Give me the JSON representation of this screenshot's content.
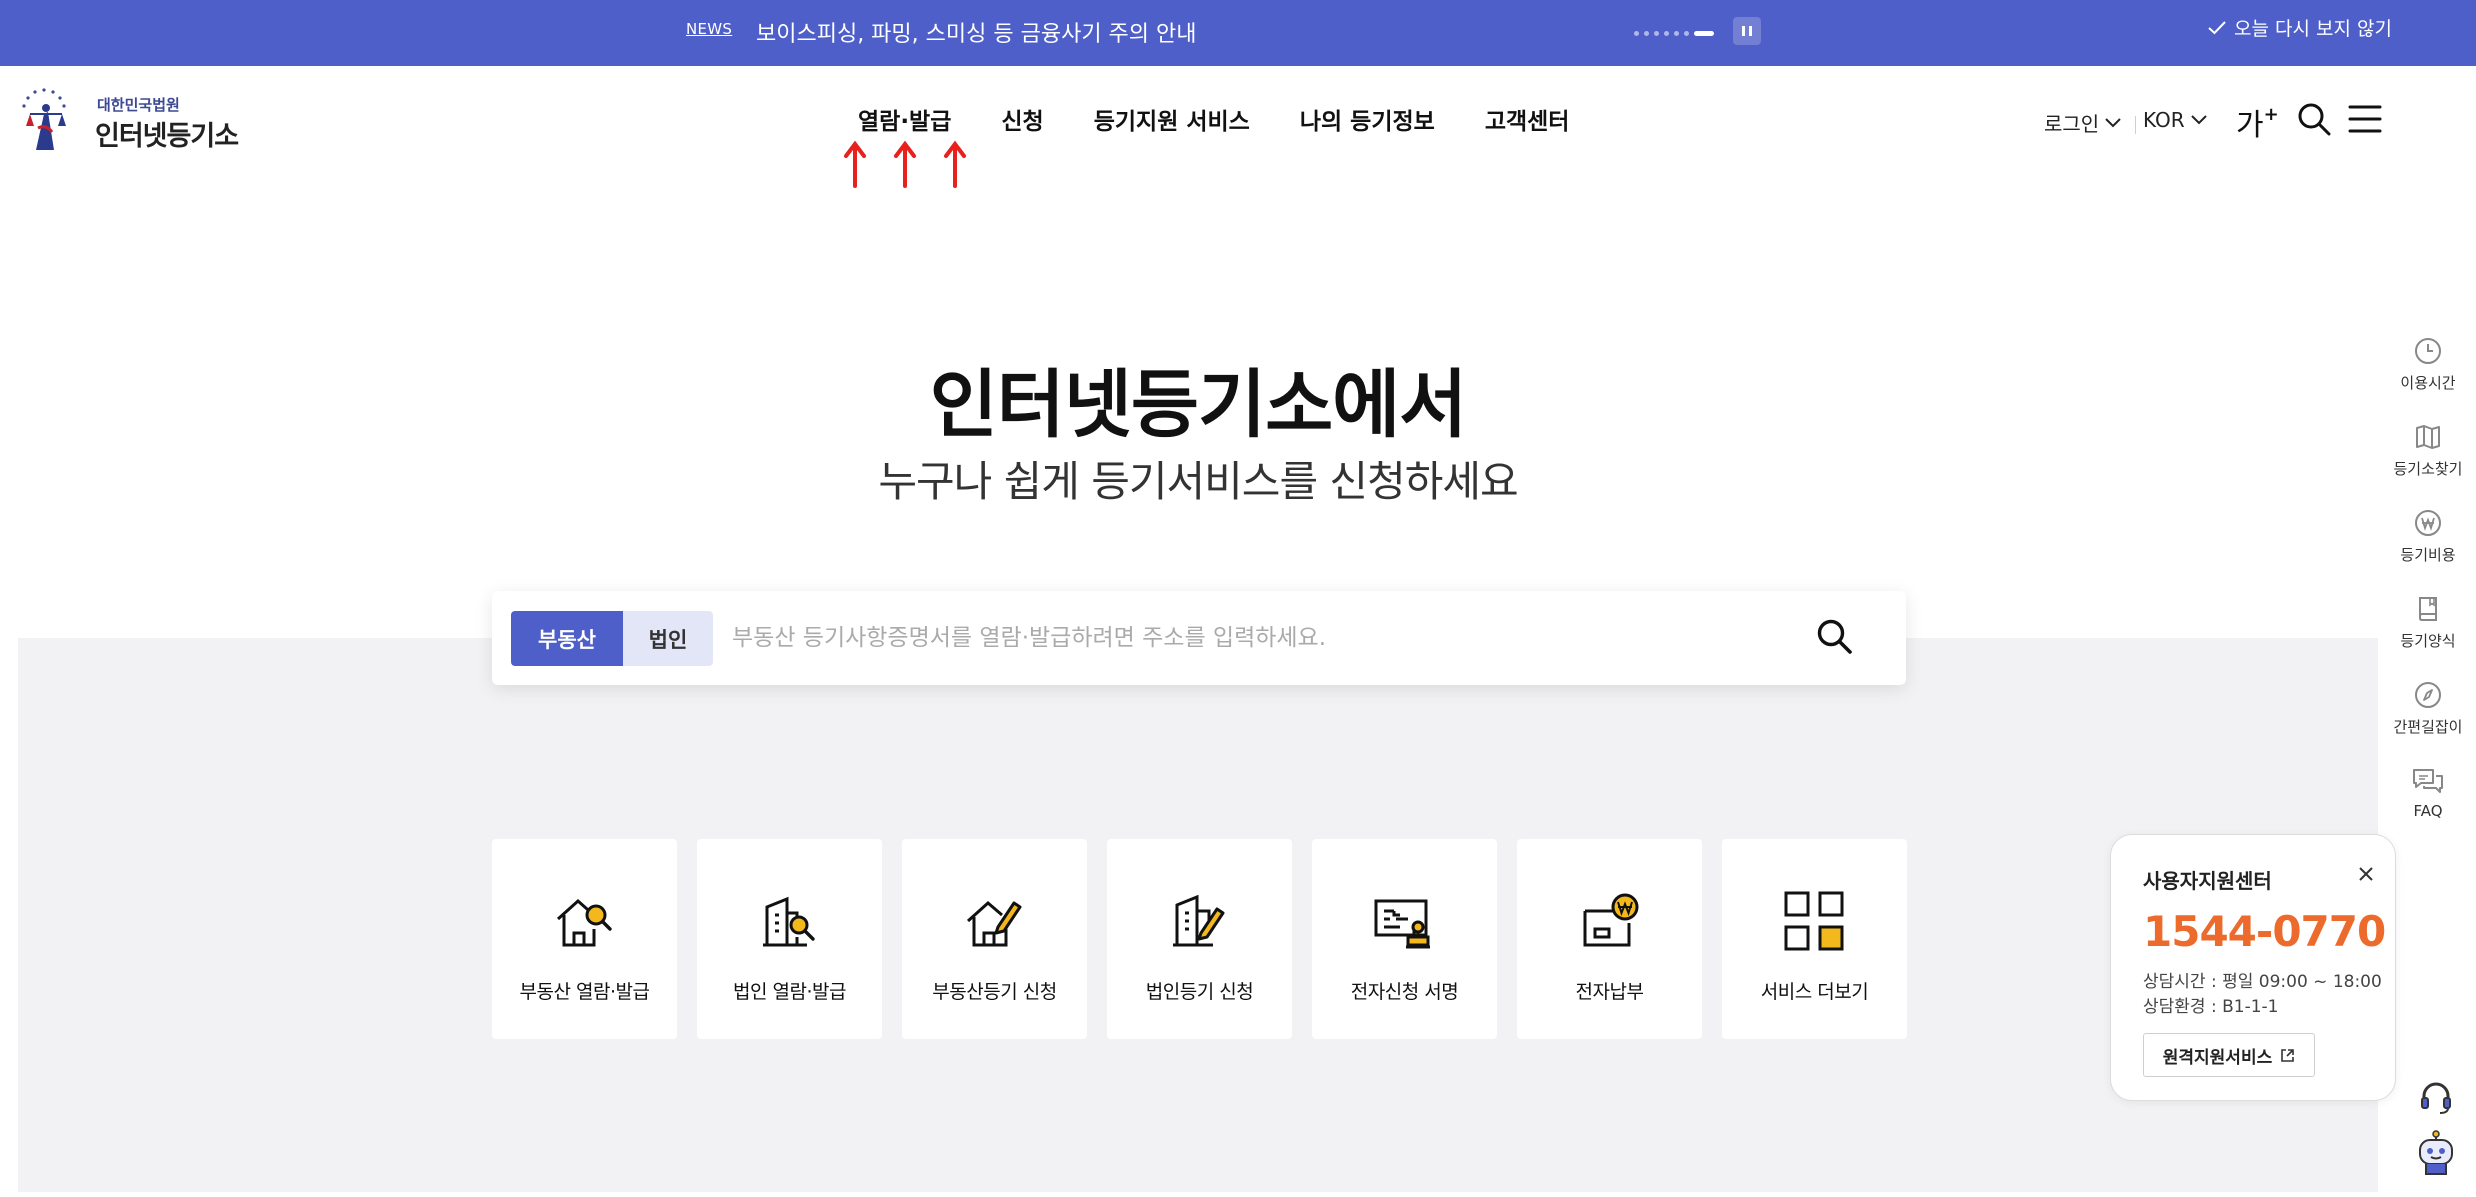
{
  "newsbar": {
    "tag": "NEWS",
    "headline": "보이스피싱, 파밍, 스미싱 등 금융사기 주의 안내",
    "dismiss_label": "오늘 다시 보지 않기",
    "icons": {
      "pause": "pause-icon",
      "check": "check-icon"
    }
  },
  "header": {
    "logo_subtitle": "대한민국법원",
    "logo_title": "인터넷등기소",
    "nav": [
      "열람·발급",
      "신청",
      "등기지원 서비스",
      "나의 등기정보",
      "고객센터"
    ],
    "login_label": "로그인",
    "language_label": "KOR",
    "font_size_label": "가",
    "font_size_plus": "+",
    "icons": {
      "search": "search-icon",
      "menu": "hamburger-menu-icon",
      "chevron": "chevron-down-icon",
      "annotation": "red-arrow-icon"
    }
  },
  "hero": {
    "title": "인터넷등기소에서",
    "subtitle": "누구나 쉽게 등기서비스를 신청하세요"
  },
  "search": {
    "tabs": [
      "부동산",
      "법인"
    ],
    "active_tab": "부동산",
    "placeholder": "부동산 등기사항증명서를 열람·발급하려면 주소를 입력하세요.",
    "value": ""
  },
  "services": [
    {
      "label": "부동산 열람·발급",
      "icon": "house-search-icon"
    },
    {
      "label": "법인 열람·발급",
      "icon": "building-search-icon"
    },
    {
      "label": "부동산등기 신청",
      "icon": "house-edit-icon"
    },
    {
      "label": "법인등기 신청",
      "icon": "building-edit-icon"
    },
    {
      "label": "전자신청 서명",
      "icon": "document-stamp-icon"
    },
    {
      "label": "전자납부",
      "icon": "won-payment-icon"
    },
    {
      "label": "서비스 더보기",
      "icon": "grid-more-icon"
    }
  ],
  "quick_menu": [
    {
      "label": "이용시간",
      "icon": "clock-icon"
    },
    {
      "label": "등기소찾기",
      "icon": "map-icon"
    },
    {
      "label": "등기비용",
      "icon": "won-coin-icon"
    },
    {
      "label": "등기양식",
      "icon": "book-icon"
    },
    {
      "label": "간편길잡이",
      "icon": "compass-icon"
    },
    {
      "label": "FAQ",
      "icon": "chat-bubbles-icon"
    }
  ],
  "support": {
    "title": "사용자지원센터",
    "phone": "1544-0770",
    "hours": "상담시간 : 평일 09:00 ~ 18:00",
    "environment": "상담환경 : B1-1-1",
    "remote_label": "원격지원서비스",
    "icons": {
      "close": "close-icon",
      "external": "external-link-icon",
      "headset": "headset-icon",
      "chatbot": "chatbot-icon"
    }
  },
  "colors": {
    "brand_blue": "#4f5fc9",
    "accent_orange": "#ec6a2c",
    "icon_yellow": "#f3b81b",
    "annotation_red": "#e8211d",
    "area_gray": "#f2f2f4"
  }
}
